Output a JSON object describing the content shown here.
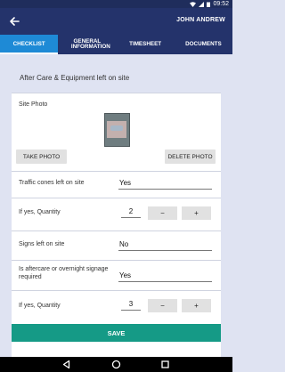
{
  "status_bar": {
    "time": "09:52",
    "icons": [
      "wifi-icon",
      "signal-icon",
      "battery-icon"
    ]
  },
  "app_bar": {
    "back_icon": "arrow-left-icon",
    "user_name": "JOHN ANDREW"
  },
  "tabs": [
    {
      "label": "CHECKLIST",
      "active": true
    },
    {
      "label": "GENERAL INFORMATION",
      "active": false
    },
    {
      "label": "TIMESHEET",
      "active": false
    },
    {
      "label": "DOCUMENTS",
      "active": false
    }
  ],
  "section_title": "After Care & Equipment left on site",
  "site_photo": {
    "label": "Site Photo",
    "take_photo_label": "TAKE PHOTO",
    "delete_photo_label": "DELETE PHOTO"
  },
  "questions": {
    "traffic_cones": {
      "label": "Traffic cones left on site",
      "value": "Yes"
    },
    "traffic_cones_qty": {
      "label": "If yes, Quantity",
      "value": "2"
    },
    "signs": {
      "label": "Signs left on site",
      "value": "No"
    },
    "aftercare_signage": {
      "label": "Is aftercare or overnight signage required",
      "value": "Yes"
    },
    "aftercare_qty": {
      "label": "If yes, Quantity",
      "value": "3"
    }
  },
  "stepper": {
    "minus": "−",
    "plus": "+"
  },
  "save_label": "SAVE",
  "nav_bar": [
    "back-triangle-icon",
    "home-circle-icon",
    "recents-square-icon"
  ],
  "colors": {
    "app_bar": "#24336b",
    "active_tab": "#1e8ad6",
    "save_button": "#159a86",
    "background": "#dfe3f2"
  }
}
